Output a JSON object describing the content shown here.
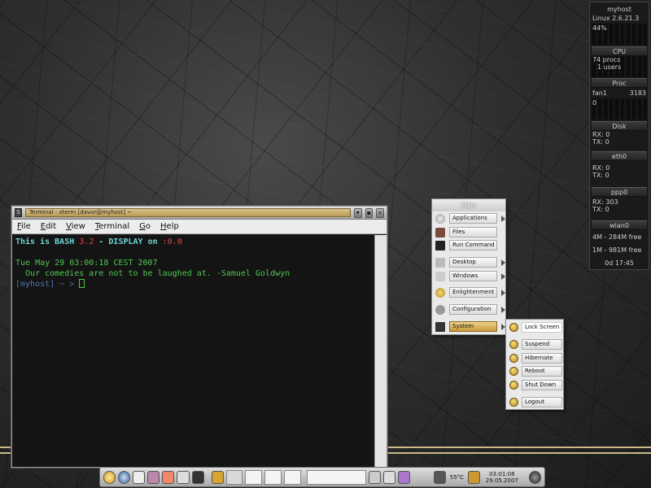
{
  "terminal": {
    "title": "Terminal - xterm [davor@myhost] ~",
    "menu": [
      "File",
      "Edit",
      "View",
      "Terminal",
      "Go",
      "Help"
    ],
    "lines": {
      "bash_prefix": "This is BASH ",
      "bash_version": "3.2",
      "display_mid": " - DISPLAY on ",
      "display_val": ":0.0",
      "date": "Tue May 29 03:00:18 CEST 2007",
      "quote": "  Our comedies are not to be laughed at. -Samuel Goldwyn",
      "prompt": "[myhost] ~ > "
    }
  },
  "emenu": {
    "title": "Main",
    "items": [
      "Applications",
      "Files",
      "Run Command",
      "Desktop",
      "Windows",
      "Enlightenment",
      "Configuration",
      "System"
    ]
  },
  "system_menu": {
    "items": [
      "Lock Screen",
      "Suspend",
      "Hibernate",
      "Reboot",
      "Shut Down",
      "Logout"
    ]
  },
  "monitor": {
    "hostname": "myhost",
    "kernel": "Linux 2.6.21.3",
    "cpu_percent": "44%",
    "cpu_label": "CPU",
    "procs": "74 procs",
    "users": "1 users",
    "proc_label": "Proc",
    "fan_label": "fan1",
    "fan_value": "3183",
    "fan_zero": "0",
    "disk_label": "Disk",
    "disk_rx": "RX: 0",
    "disk_tx": "TX: 0",
    "eth_label": "eth0",
    "eth_rx": "RX: 0",
    "eth_tx": "TX: 0",
    "ppp_label": "ppp0",
    "ppp_rx": "RX: 303",
    "ppp_tx": "TX: 0",
    "wlan_label": "wlan0",
    "mem": "4M - 284M free",
    "swap": "1M - 981M free",
    "uptime": "0d 17:45"
  },
  "taskbar": {
    "temperature": "55°C",
    "time": "03:01:08",
    "date": "29.05.2007"
  }
}
